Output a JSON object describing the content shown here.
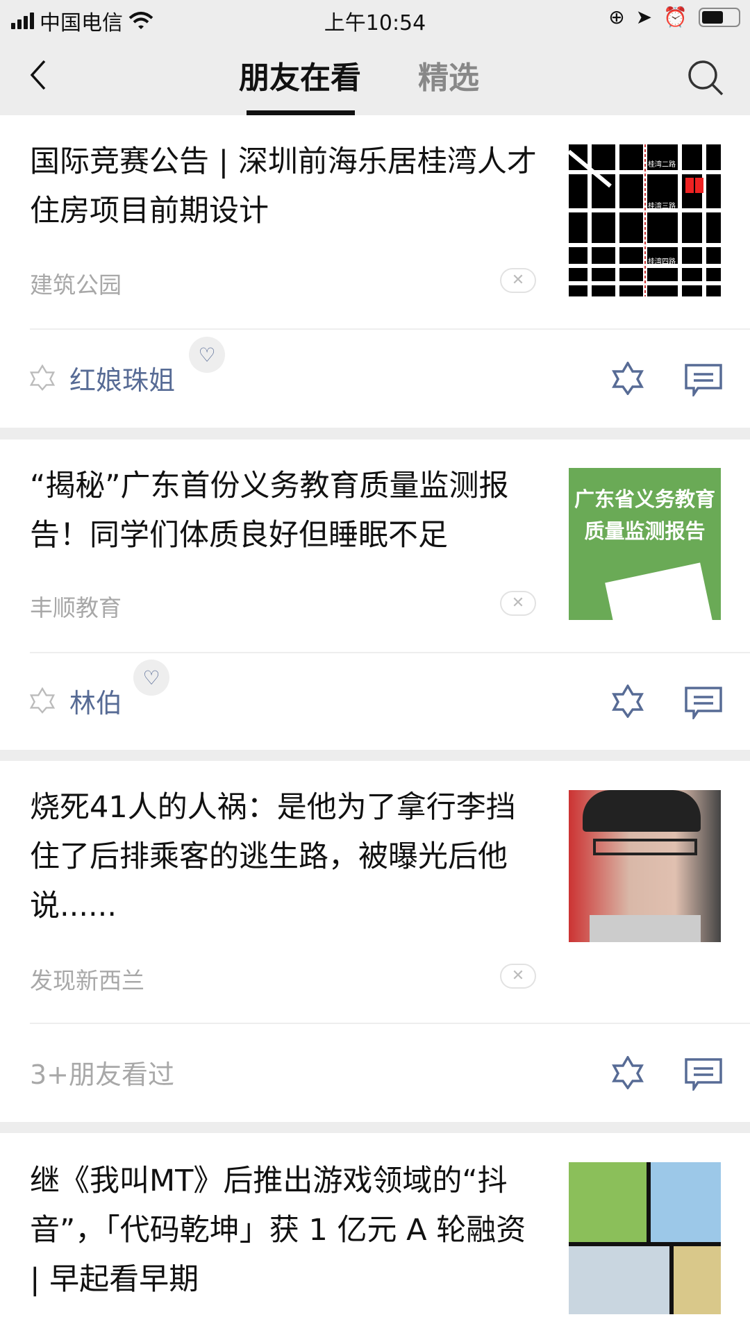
{
  "status_bar": {
    "carrier": "中国电信",
    "time": "上午10:54"
  },
  "nav": {
    "tabs": [
      {
        "label": "朋友在看",
        "active": true
      },
      {
        "label": "精选",
        "active": false
      }
    ]
  },
  "accent_color": "#576b95",
  "articles": [
    {
      "title": "国际竞赛公告 | 深圳前海乐居桂湾人才住房项目前期设计",
      "source": "建筑公园",
      "friend": "红娘珠姐",
      "liked": true,
      "thumb_labels": [
        "桂湾二路",
        "桂湾三路",
        "桂湾四路"
      ]
    },
    {
      "title": "“揭秘”广东首份义务教育质量监测报告！同学们体质良好但睡眠不足",
      "source": "丰顺教育",
      "friend": "林伯",
      "liked": true,
      "thumb_text": [
        "广东省义务教育",
        "质量监测报告"
      ]
    },
    {
      "title": "烧死41人的人祸：是他为了拿行李挡住了后排乘客的逃生路，被曝光后他说......",
      "source": "发现新西兰",
      "friend": "3+朋友看过",
      "liked": false
    },
    {
      "title": "继《我叫MT》后推出游戏领域的“抖音”，「代码乾坤」获 1 亿元 A 轮融资 | 早起看早期"
    }
  ]
}
